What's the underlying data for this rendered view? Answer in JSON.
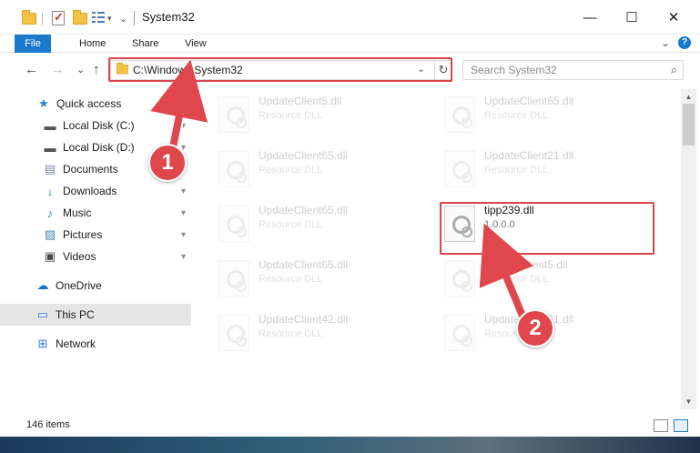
{
  "window": {
    "title": "System32",
    "controls": {
      "minimize": "—",
      "maximize": "☐",
      "close": "✕"
    }
  },
  "ribbon": {
    "tabs": [
      "File",
      "Home",
      "Share",
      "View"
    ],
    "expand_icon": "chevron-down-icon",
    "help_icon": "?"
  },
  "nav": {
    "back": "←",
    "forward": "→",
    "recent": "⌄",
    "up": "↑",
    "address": "C:\\Windows\\System32",
    "dropdown": "⌄",
    "refresh": "↻",
    "search_placeholder": "Search System32",
    "search_icon": "⌕"
  },
  "sidebar": {
    "items": [
      {
        "label": "Quick access",
        "icon": "star-icon",
        "glyph": "★",
        "color": "#2f7ed8"
      },
      {
        "label": "Local Disk (C:)",
        "icon": "drive-icon",
        "glyph": "▬",
        "color": "#555555",
        "pinned": true
      },
      {
        "label": "Local Disk (D:)",
        "icon": "drive-icon",
        "glyph": "▬",
        "color": "#555555",
        "pinned": true
      },
      {
        "label": "Documents",
        "icon": "documents-icon",
        "glyph": "▤",
        "color": "#7a8aa0",
        "pinned": true
      },
      {
        "label": "Downloads",
        "icon": "downloads-icon",
        "glyph": "↓",
        "color": "#2f7ed8",
        "pinned": true
      },
      {
        "label": "Music",
        "icon": "music-icon",
        "glyph": "♪",
        "color": "#2f7ed8",
        "pinned": true
      },
      {
        "label": "Pictures",
        "icon": "pictures-icon",
        "glyph": "▨",
        "color": "#4a8ab5",
        "pinned": true
      },
      {
        "label": "Videos",
        "icon": "videos-icon",
        "glyph": "▣",
        "color": "#4a4a4a",
        "pinned": true
      },
      {
        "label": "OneDrive",
        "icon": "cloud-icon",
        "glyph": "☁",
        "color": "#1a6fc4"
      },
      {
        "label": "This PC",
        "icon": "computer-icon",
        "glyph": "▭",
        "color": "#2f7ed8",
        "selected": true
      },
      {
        "label": "Network",
        "icon": "network-icon",
        "glyph": "⊞",
        "color": "#2f7ed8"
      }
    ],
    "pin_glyph": "📌"
  },
  "files": [
    {
      "name": "UpdateClient5.dll",
      "type": "Resource DLL",
      "faded": true
    },
    {
      "name": "UpdateClient65.dll",
      "type": "Resource DLL",
      "faded": true
    },
    {
      "name": "UpdateClient65.dll",
      "type": "Resource DLL",
      "faded": true
    },
    {
      "name": "UpdateClient21.dll",
      "type": "Resource DLL",
      "faded": true
    },
    {
      "name": "UpdateClient65.dll",
      "type": "Resource DLL",
      "faded": true
    },
    {
      "name": "tipp239.dll",
      "type": "1.0.0.0",
      "extra": "na",
      "faded": false
    },
    {
      "name": "UpdateClient65.dll",
      "type": "Resource DLL",
      "faded": true
    },
    {
      "name": "UpdateClient5.dll",
      "type": "Resource DLL",
      "faded": true
    },
    {
      "name": "UpdateClient42.dll",
      "type": "Resource DLL",
      "faded": true
    },
    {
      "name": "UpdateClient21.dll",
      "type": "Resource DLL",
      "faded": true
    }
  ],
  "status": {
    "item_count": "146 items"
  },
  "callouts": [
    "1",
    "2"
  ],
  "colors": {
    "accent": "#1979ca",
    "highlight": "#d9464a",
    "callout": "#e0474c"
  }
}
